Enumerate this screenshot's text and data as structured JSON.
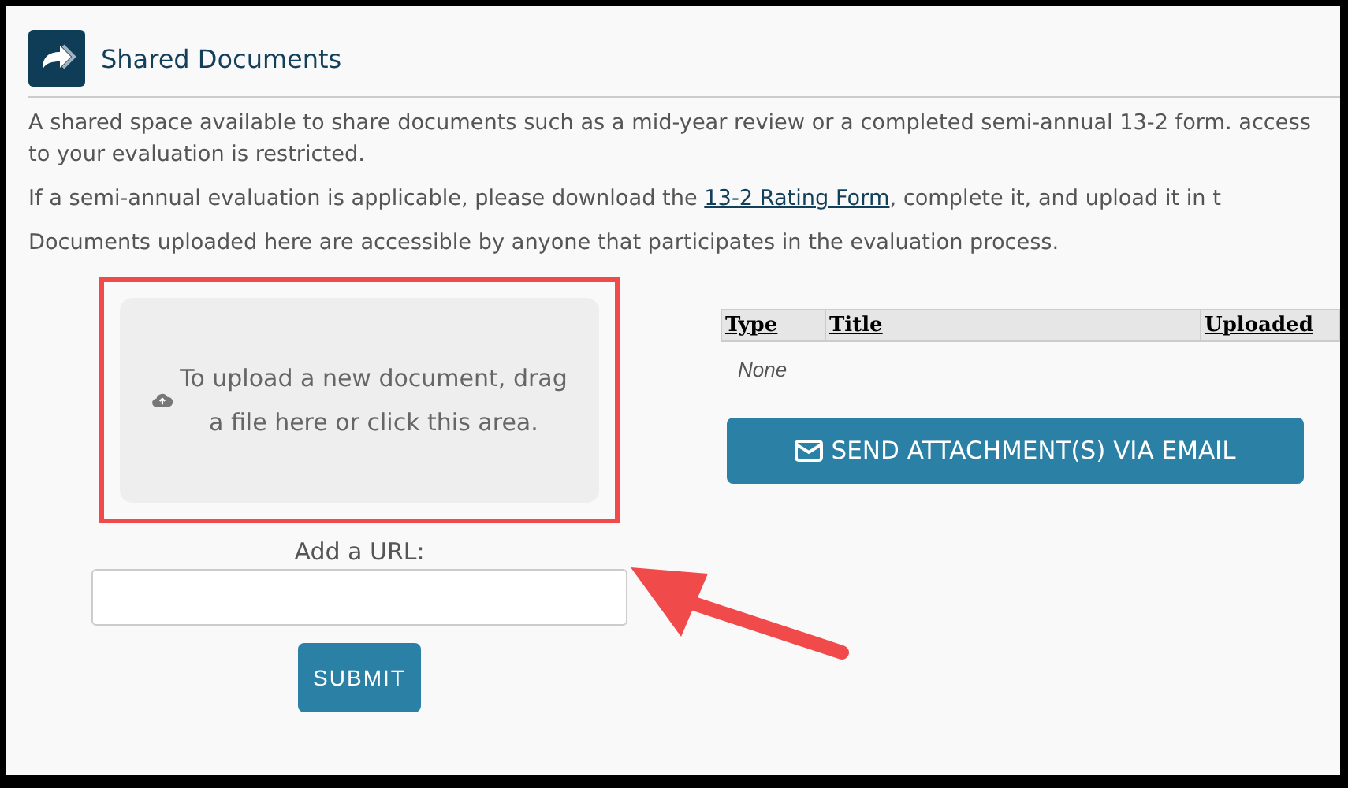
{
  "header": {
    "title": "Shared Documents"
  },
  "paragraphs": [
    {
      "text": "A shared space available to share documents such as a mid-year review or a completed semi-annual 13-2 form. access to your evaluation is restricted."
    },
    {
      "before": "If a semi-annual evaluation is applicable, please download the ",
      "link": "13-2 Rating Form",
      "after": ", complete it, and upload it in t"
    },
    {
      "text": "Documents uploaded here are accessible by anyone that participates in the evaluation process."
    }
  ],
  "upload": {
    "text": "To upload a new document, drag a file here or click this area.",
    "highlighted": true
  },
  "url": {
    "label": "Add a URL:",
    "button": "SUBMIT"
  },
  "table": {
    "columns": [
      "Type",
      "Title",
      "Uploaded"
    ],
    "empty": "None"
  },
  "email_button": "SEND ATTACHMENT(S) VIA EMAIL"
}
